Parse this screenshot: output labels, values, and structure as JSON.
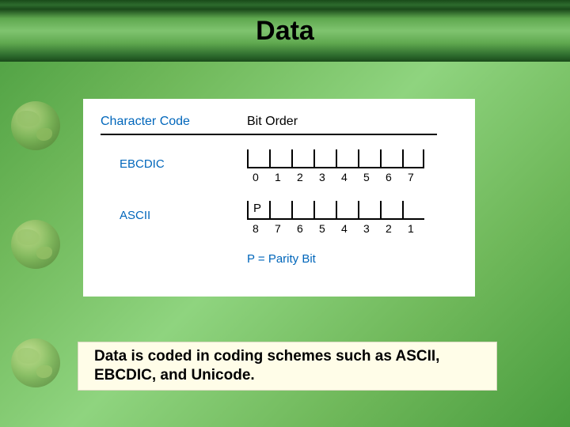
{
  "title": "Data",
  "diagram": {
    "header_col1": "Character Code",
    "header_col2": "Bit Order",
    "rows": [
      {
        "label": "EBCDIC",
        "bits": [
          "0",
          "1",
          "2",
          "3",
          "4",
          "5",
          "6",
          "7"
        ],
        "parity_mark": ""
      },
      {
        "label": "ASCII",
        "bits": [
          "8",
          "7",
          "6",
          "5",
          "4",
          "3",
          "2",
          "1"
        ],
        "parity_mark": "P"
      }
    ],
    "parity_note": "P = Parity Bit"
  },
  "caption": "Data is coded in coding schemes such as ASCII, EBCDIC, and Unicode."
}
